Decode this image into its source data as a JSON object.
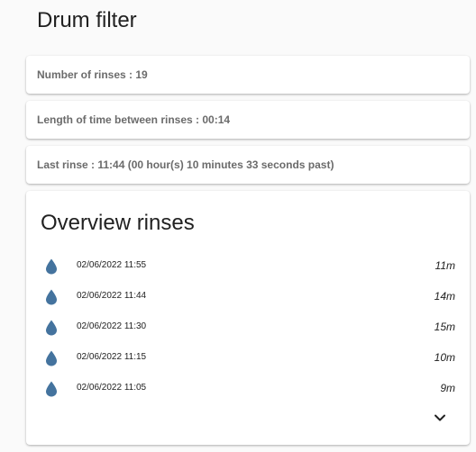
{
  "page": {
    "title": "Drum filter"
  },
  "cards": {
    "rinse_count": "Number of rinses : 19",
    "interval": "Length of time between rinses : 00:14",
    "last_rinse": "Last rinse : 11:44 (00 hour(s) 10 minutes 33 seconds past)"
  },
  "overview": {
    "title": "Overview rinses",
    "icon": "water-drop-icon",
    "icon_color": "#44739e",
    "expand_icon": "chevron-down-icon",
    "items": [
      {
        "time": "02/06/2022 11:55",
        "duration": "11m"
      },
      {
        "time": "02/06/2022 11:44",
        "duration": "14m"
      },
      {
        "time": "02/06/2022 11:30",
        "duration": "15m"
      },
      {
        "time": "02/06/2022 11:15",
        "duration": "10m"
      },
      {
        "time": "02/06/2022 11:05",
        "duration": "9m"
      }
    ]
  }
}
